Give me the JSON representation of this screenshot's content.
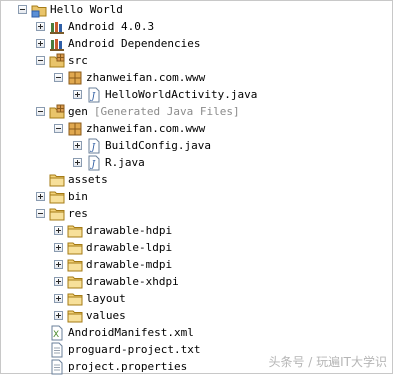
{
  "project": {
    "name": "Hello World"
  },
  "items": {
    "android_lib": "Android 4.0.3",
    "android_deps": "Android Dependencies",
    "src": "src",
    "src_pkg": "zhanweifan.com.www",
    "hello_activity": "HelloWorldActivity.java",
    "gen": "gen",
    "gen_decoration": "[Generated Java Files]",
    "gen_pkg": "zhanweifan.com.www",
    "build_config": "BuildConfig.java",
    "r_java": "R.java",
    "assets": "assets",
    "bin": "bin",
    "res": "res",
    "drawable_hdpi": "drawable-hdpi",
    "drawable_ldpi": "drawable-ldpi",
    "drawable_mdpi": "drawable-mdpi",
    "drawable_xhdpi": "drawable-xhdpi",
    "layout": "layout",
    "values": "values",
    "manifest": "AndroidManifest.xml",
    "proguard": "proguard-project.txt",
    "properties": "project.properties"
  },
  "watermark": "头条号 / 玩遍IT大学识",
  "icons": {
    "project": "project-folder-icon",
    "library": "library-books-icon",
    "source_folder": "source-folder-icon",
    "package": "package-icon",
    "java_file": "java-file-icon",
    "folder": "folder-icon",
    "xml_file": "xml-file-icon",
    "text_file": "text-file-icon"
  }
}
